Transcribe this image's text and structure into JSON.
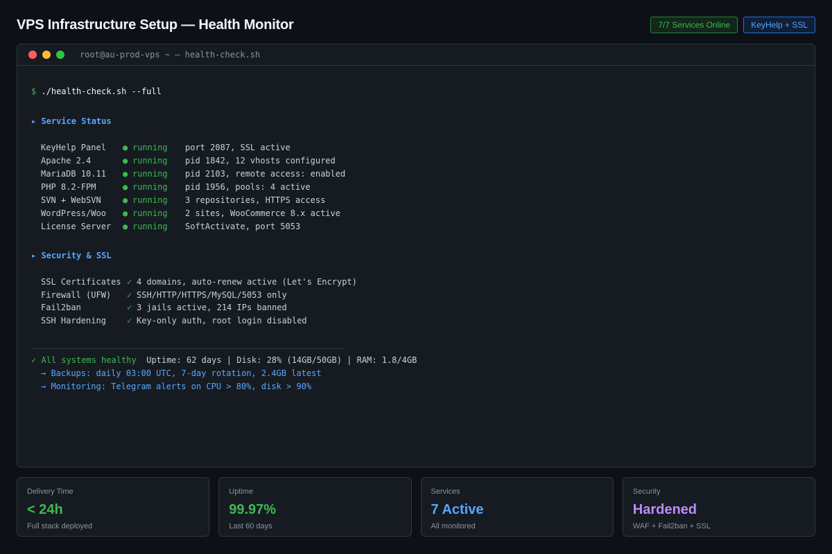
{
  "header": {
    "title": "VPS Infrastructure Setup — Health Monitor",
    "badge_services": "7/7 Services Online",
    "badge_ssl": "KeyHelp + SSL"
  },
  "terminal": {
    "title": "root@au-prod-vps ~ — health-check.sh",
    "prompt": "$",
    "command": "./health-check.sh --full",
    "service_section": "▸ Service Status",
    "services": [
      {
        "name": "KeyHelp Panel",
        "status": "running",
        "detail": "port 2087, SSL active"
      },
      {
        "name": "Apache 2.4",
        "status": "running",
        "detail": "pid 1842, 12 vhosts configured"
      },
      {
        "name": "MariaDB 10.11",
        "status": "running",
        "detail": "pid 2103, remote access: enabled"
      },
      {
        "name": "PHP 8.2-FPM",
        "status": "running",
        "detail": "pid 1956, pools: 4 active"
      },
      {
        "name": "SVN + WebSVN",
        "status": "running",
        "detail": "3 repositories, HTTPS access"
      },
      {
        "name": "WordPress/Woo",
        "status": "running",
        "detail": "2 sites, WooCommerce 8.x active"
      },
      {
        "name": "License Server",
        "status": "running",
        "detail": "SoftActivate, port 5053"
      }
    ],
    "security_section": "▸ Security & SSL",
    "security": [
      {
        "name": "SSL Certificates",
        "detail": "4 domains, auto-renew active (Let's Encrypt)"
      },
      {
        "name": "Firewall (UFW)",
        "detail": "SSH/HTTP/HTTPS/MySQL/5053 only"
      },
      {
        "name": "Fail2ban",
        "detail": "3 jails active, 214 IPs banned"
      },
      {
        "name": "SSH Hardening",
        "detail": "Key-only auth, root login disabled"
      }
    ],
    "summary_ok": "✓ All systems healthy",
    "summary_stats": "Uptime: 62 days | Disk: 28% (14GB/50GB) | RAM: 1.8/4GB",
    "note_backups": "→ Backups: daily 03:00 UTC, 7-day rotation, 2.4GB latest",
    "note_monitoring": "→ Monitoring: Telegram alerts on CPU > 80%, disk > 90%"
  },
  "cards": [
    {
      "label": "Delivery Time",
      "value": "< 24h",
      "sub": "Full stack deployed",
      "color": "#3fb950"
    },
    {
      "label": "Uptime",
      "value": "99.97%",
      "sub": "Last 60 days",
      "color": "#3fb950"
    },
    {
      "label": "Services",
      "value": "7 Active",
      "sub": "All monitored",
      "color": "#58a6ff"
    },
    {
      "label": "Security",
      "value": "Hardened",
      "sub": "WAF + Fail2ban + SSL",
      "color": "#bc8cff"
    }
  ]
}
